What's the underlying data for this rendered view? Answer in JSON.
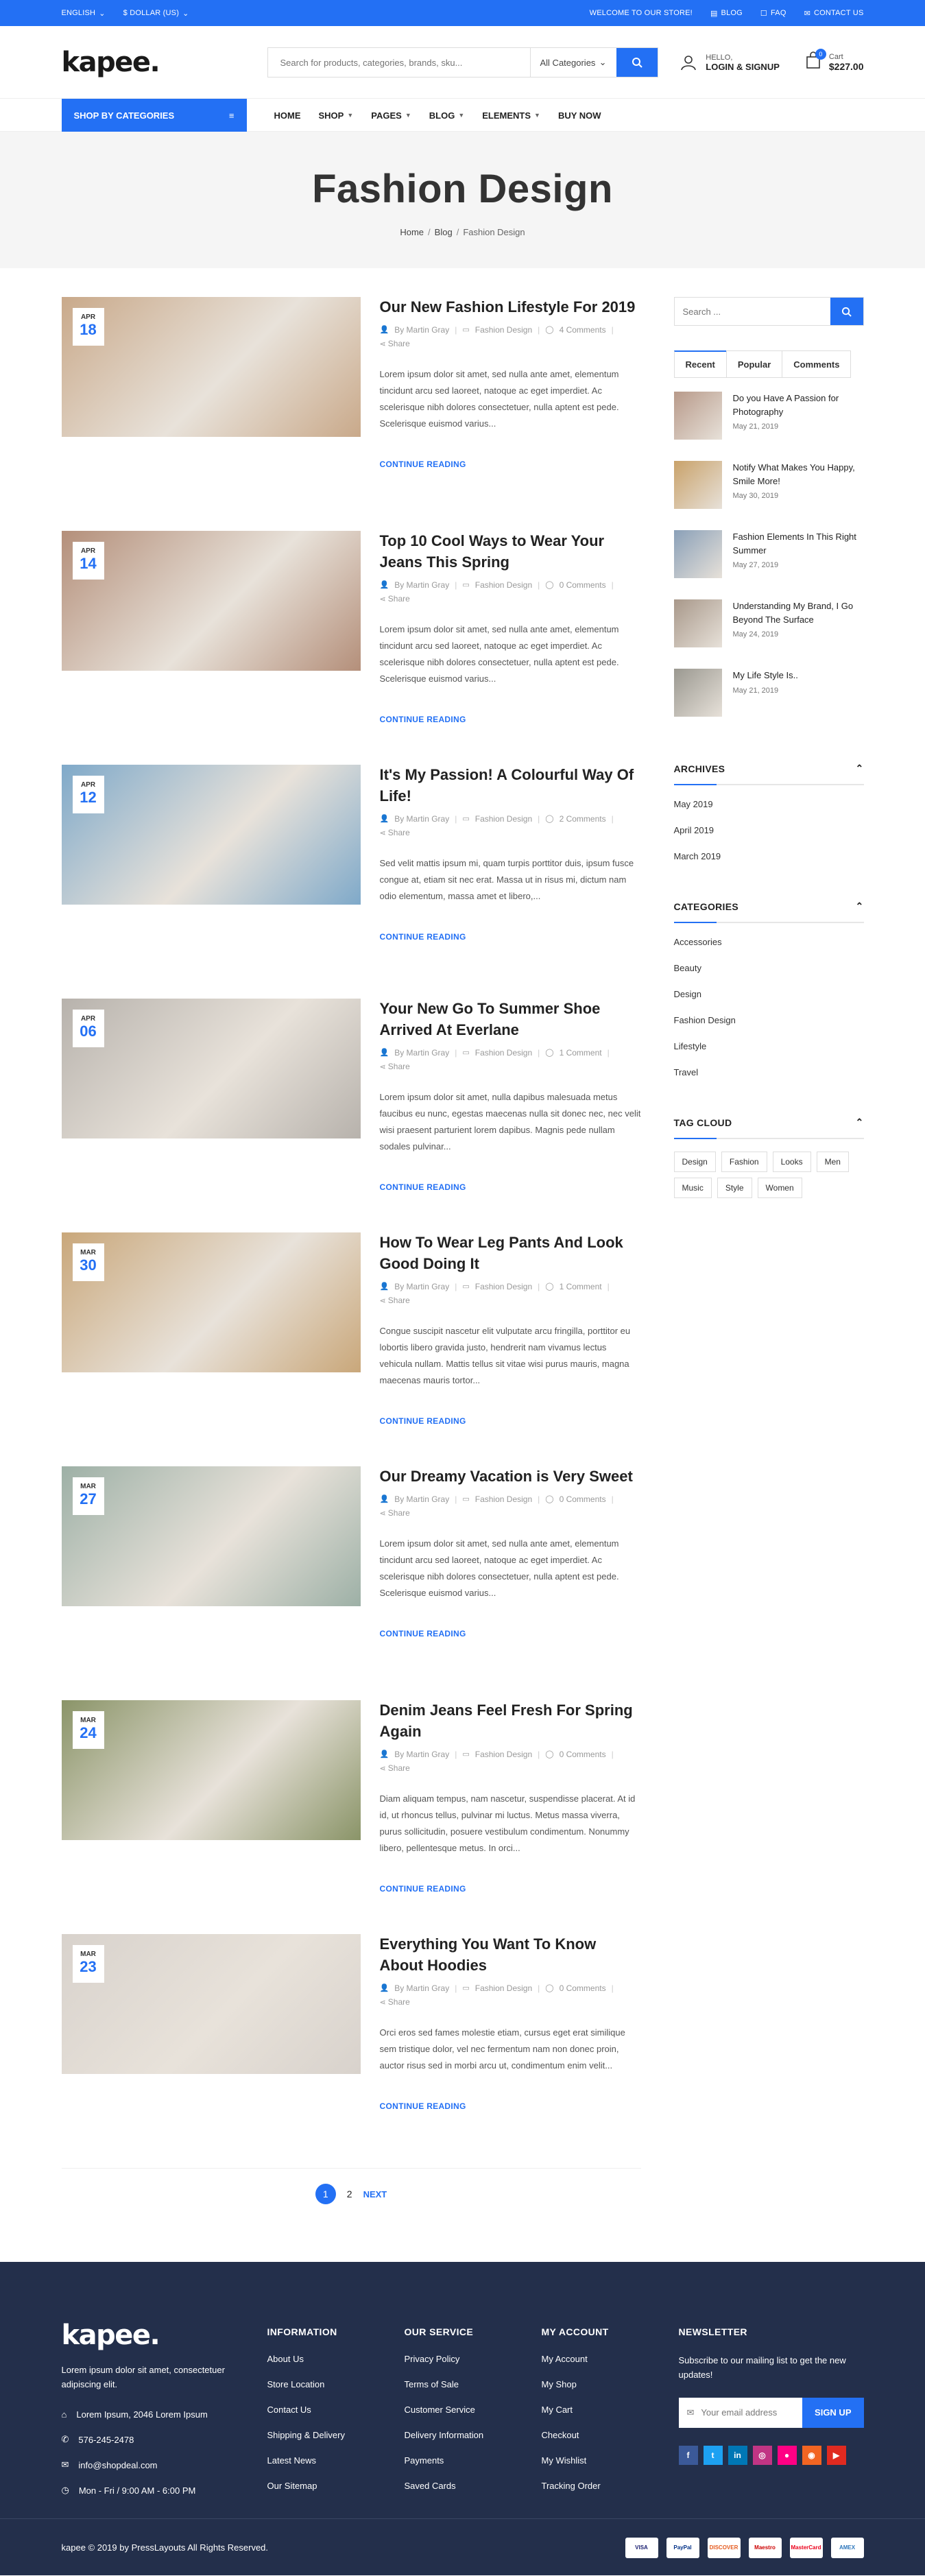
{
  "topbar": {
    "language": "ENGLISH",
    "currency": "$ DOLLAR (US)",
    "welcome": "WELCOME TO OUR STORE!",
    "blog": "BLOG",
    "faq": "FAQ",
    "contact": "CONTACT US"
  },
  "header": {
    "logo": "kapee.",
    "search_placeholder": "Search for products, categories, brands, sku...",
    "category_select": "All Categories",
    "hello": "HELLO,",
    "login": "LOGIN & SIGNUP",
    "cart_label": "Cart",
    "cart_count": "0",
    "cart_total": "$227.00"
  },
  "nav": {
    "categories_button": "SHOP BY CATEGORIES",
    "items": [
      "HOME",
      "SHOP",
      "PAGES",
      "BLOG",
      "ELEMENTS",
      "BUY NOW"
    ]
  },
  "page": {
    "title": "Fashion Design",
    "breadcrumb": [
      "Home",
      "Blog",
      "Fashion Design"
    ]
  },
  "posts": [
    {
      "month": "APR",
      "day": "18",
      "title": "Our New Fashion Lifestyle For 2019",
      "author": "By Martin Gray",
      "category": "Fashion Design",
      "comments": "4 Comments",
      "share": "Share",
      "excerpt": "Lorem ipsum dolor sit amet, sed nulla ante amet, elementum tincidunt arcu sed laoreet, natoque ac eget imperdiet. Ac scelerisque nibh dolores consectetuer, nulla aptent est pede. Scelerisque euismod varius...",
      "read_more": "CONTINUE READING",
      "img_color": "#c9a98a"
    },
    {
      "month": "APR",
      "day": "14",
      "title": "Top 10 Cool Ways to Wear Your Jeans This Spring",
      "author": "By Martin Gray",
      "category": "Fashion Design",
      "comments": "0 Comments",
      "share": "Share",
      "excerpt": "Lorem ipsum dolor sit amet, sed nulla ante amet, elementum tincidunt arcu sed laoreet, natoque ac eget imperdiet. Ac scelerisque nibh dolores consectetuer, nulla aptent est pede. Scelerisque euismod varius...",
      "read_more": "CONTINUE READING",
      "img_color": "#b48f7a"
    },
    {
      "month": "APR",
      "day": "12",
      "title": "It's My Passion! A Colourful Way Of Life!",
      "author": "By Martin Gray",
      "category": "Fashion Design",
      "comments": "2 Comments",
      "share": "Share",
      "excerpt": "Sed velit mattis ipsum mi, quam turpis porttitor duis, ipsum fusce congue at, etiam sit nec erat. Massa ut in risus mi, dictum nam odio elementum, massa amet et libero,...",
      "read_more": "CONTINUE READING",
      "img_color": "#7fa9c9"
    },
    {
      "month": "APR",
      "day": "06",
      "title": "Your New Go To Summer Shoe Arrived At Everlane",
      "author": "By Martin Gray",
      "category": "Fashion Design",
      "comments": "1 Comment",
      "share": "Share",
      "excerpt": "Lorem ipsum dolor sit amet, nulla dapibus malesuada metus faucibus eu nunc, egestas maecenas nulla sit donec nec, nec velit wisi praesent parturient lorem dapibus. Magnis pede nullam sodales pulvinar...",
      "read_more": "CONTINUE READING",
      "img_color": "#b7b2ac"
    },
    {
      "month": "MAR",
      "day": "30",
      "title": "How To Wear Leg Pants And Look Good Doing It",
      "author": "By Martin Gray",
      "category": "Fashion Design",
      "comments": "1 Comment",
      "share": "Share",
      "excerpt": "Congue suscipit nascetur elit vulputate arcu fringilla, porttitor eu lobortis libero gravida justo, hendrerit nam vivamus lectus vehicula nullam. Mattis tellus sit vitae wisi purus mauris, magna maecenas mauris tortor...",
      "read_more": "CONTINUE READING",
      "img_color": "#c9a77a"
    },
    {
      "month": "MAR",
      "day": "27",
      "title": "Our Dreamy Vacation is Very Sweet",
      "author": "By Martin Gray",
      "category": "Fashion Design",
      "comments": "0 Comments",
      "share": "Share",
      "excerpt": "Lorem ipsum dolor sit amet, sed nulla ante amet, elementum tincidunt arcu sed laoreet, natoque ac eget imperdiet. Ac scelerisque nibh dolores consectetuer, nulla aptent est pede. Scelerisque euismod varius...",
      "read_more": "CONTINUE READING",
      "img_color": "#9db0a6"
    },
    {
      "month": "MAR",
      "day": "24",
      "title": "Denim Jeans Feel Fresh For Spring Again",
      "author": "By Martin Gray",
      "category": "Fashion Design",
      "comments": "0 Comments",
      "share": "Share",
      "excerpt": "Diam aliquam tempus, nam nascetur, suspendisse placerat. At id id, ut rhoncus tellus, pulvinar mi luctus. Metus massa viverra, purus sollicitudin, posuere vestibulum condimentum. Nonummy libero, pellentesque metus. In orci...",
      "read_more": "CONTINUE READING",
      "img_color": "#8a9468"
    },
    {
      "month": "MAR",
      "day": "23",
      "title": "Everything You Want To Know About Hoodies",
      "author": "By Martin Gray",
      "category": "Fashion Design",
      "comments": "0 Comments",
      "share": "Share",
      "excerpt": "Orci eros sed fames molestie etiam, cursus eget erat similique sem tristique dolor, vel nec fermentum nam non donec proin, auctor risus sed in morbi arcu ut, condimentum enim velit...",
      "read_more": "CONTINUE READING",
      "img_color": "#d8d2cc"
    }
  ],
  "pagination": {
    "current": "1",
    "next_page": "2",
    "next_label": "NEXT"
  },
  "sidebar": {
    "search_placeholder": "Search ...",
    "tabs": [
      "Recent",
      "Popular",
      "Comments"
    ],
    "recent": [
      {
        "title": "Do you Have A Passion for Photography",
        "date": "May 21, 2019",
        "color": "#b89a8a"
      },
      {
        "title": "Notify What Makes You Happy, Smile More!",
        "date": "May 30, 2019",
        "color": "#c9a26a"
      },
      {
        "title": "Fashion Elements In This Right Summer",
        "date": "May 27, 2019",
        "color": "#8aa0b8"
      },
      {
        "title": "Understanding My Brand, I Go Beyond The Surface",
        "date": "May 24, 2019",
        "color": "#a8988a"
      },
      {
        "title": "My Life Style Is..",
        "date": "May 21, 2019",
        "color": "#9a9890"
      }
    ],
    "archives_title": "ARCHIVES",
    "archives": [
      "May 2019",
      "April 2019",
      "March 2019"
    ],
    "categories_title": "CATEGORIES",
    "categories": [
      "Accessories",
      "Beauty",
      "Design",
      "Fashion Design",
      "Lifestyle",
      "Travel"
    ],
    "tags_title": "TAG CLOUD",
    "tags": [
      "Design",
      "Fashion",
      "Looks",
      "Men",
      "Music",
      "Style",
      "Women"
    ]
  },
  "footer": {
    "logo": "kapee.",
    "description": "Lorem ipsum dolor sit amet, consectetuer adipiscing elit.",
    "address": "Lorem Ipsum, 2046 Lorem Ipsum",
    "phone": "576-245-2478",
    "email": "info@shopdeal.com",
    "hours": "Mon - Fri / 9:00 AM - 6:00 PM",
    "information_title": "INFORMATION",
    "information": [
      "About Us",
      "Store Location",
      "Contact Us",
      "Shipping & Delivery",
      "Latest News",
      "Our Sitemap"
    ],
    "service_title": "OUR SERVICE",
    "service": [
      "Privacy Policy",
      "Terms of Sale",
      "Customer Service",
      "Delivery Information",
      "Payments",
      "Saved Cards"
    ],
    "account_title": "MY ACCOUNT",
    "account": [
      "My Account",
      "My Shop",
      "My Cart",
      "Checkout",
      "My Wishlist",
      "Tracking Order"
    ],
    "newsletter_title": "NEWSLETTER",
    "newsletter_text": "Subscribe to our mailing list to get the new updates!",
    "email_placeholder": "Your email address",
    "signup": "SIGN UP",
    "social": [
      {
        "name": "facebook",
        "letter": "f",
        "color": "#3b5998"
      },
      {
        "name": "twitter",
        "letter": "t",
        "color": "#1da1f2"
      },
      {
        "name": "linkedin",
        "letter": "in",
        "color": "#0077b5"
      },
      {
        "name": "instagram",
        "letter": "◎",
        "color": "#c13584"
      },
      {
        "name": "flickr",
        "letter": "●",
        "color": "#ff0084"
      },
      {
        "name": "rss",
        "letter": "◉",
        "color": "#f26522"
      },
      {
        "name": "youtube",
        "letter": "▶",
        "color": "#e02a20"
      }
    ],
    "copyright": "kapee © 2019 by PressLayouts All Rights Reserved.",
    "payments": [
      {
        "name": "VISA",
        "color": "#1a1f71"
      },
      {
        "name": "PayPal",
        "color": "#003087"
      },
      {
        "name": "DISCOVER",
        "color": "#e55c20"
      },
      {
        "name": "Maestro",
        "color": "#cc0000"
      },
      {
        "name": "MasterCard",
        "color": "#eb001b"
      },
      {
        "name": "AMEX",
        "color": "#2e77bc"
      }
    ]
  }
}
